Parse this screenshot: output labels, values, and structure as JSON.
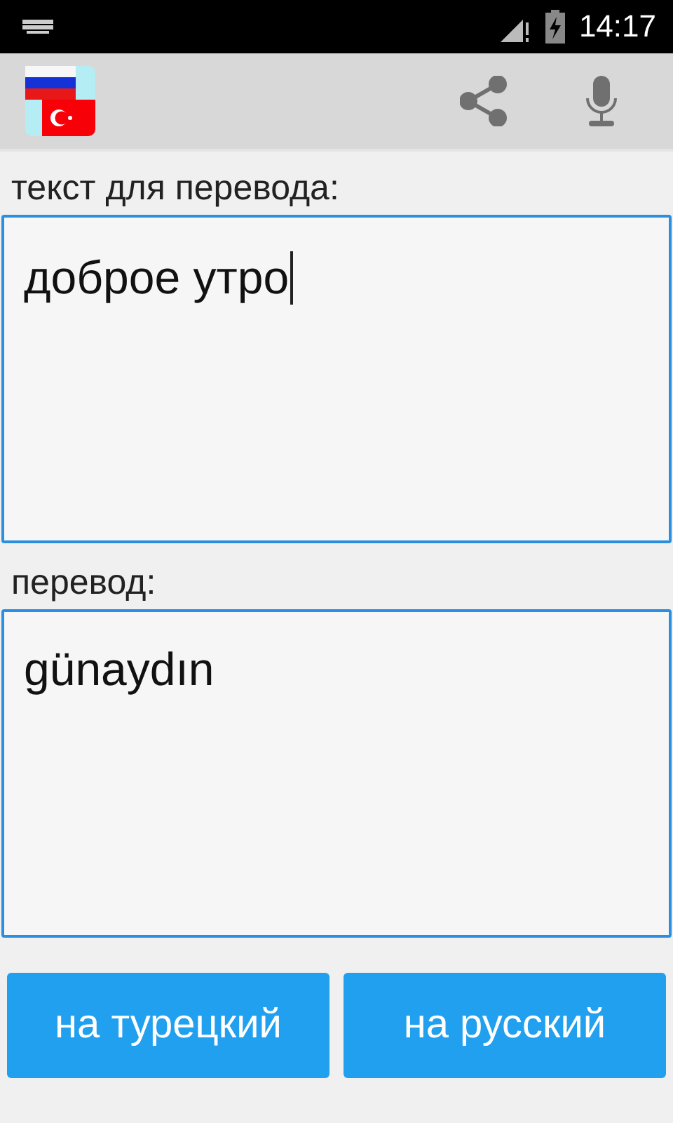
{
  "status_bar": {
    "time": "14:17"
  },
  "source": {
    "label": "текст для перевода:",
    "value": "доброе утро"
  },
  "target": {
    "label": "перевод:",
    "value": "günaydın"
  },
  "buttons": [
    {
      "label": "на турецкий"
    },
    {
      "label": "на русский"
    }
  ]
}
